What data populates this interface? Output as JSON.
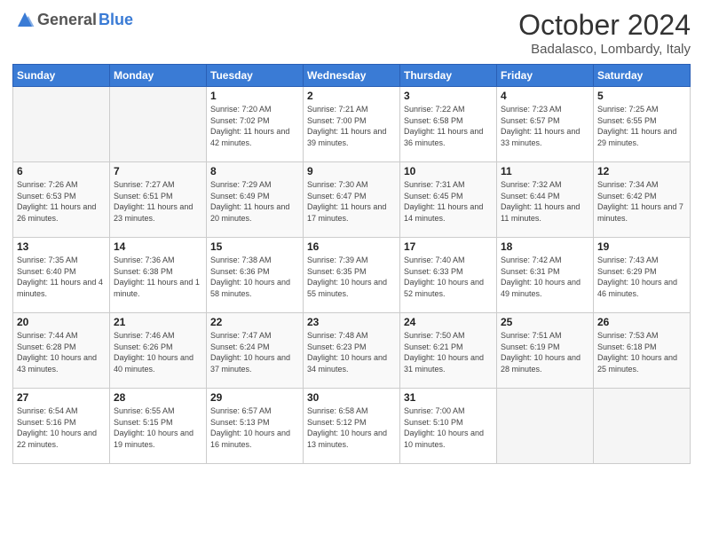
{
  "logo": {
    "general": "General",
    "blue": "Blue"
  },
  "header": {
    "month": "October 2024",
    "location": "Badalasco, Lombardy, Italy"
  },
  "days_of_week": [
    "Sunday",
    "Monday",
    "Tuesday",
    "Wednesday",
    "Thursday",
    "Friday",
    "Saturday"
  ],
  "weeks": [
    [
      {
        "day": "",
        "info": ""
      },
      {
        "day": "",
        "info": ""
      },
      {
        "day": "1",
        "info": "Sunrise: 7:20 AM\nSunset: 7:02 PM\nDaylight: 11 hours and 42 minutes."
      },
      {
        "day": "2",
        "info": "Sunrise: 7:21 AM\nSunset: 7:00 PM\nDaylight: 11 hours and 39 minutes."
      },
      {
        "day": "3",
        "info": "Sunrise: 7:22 AM\nSunset: 6:58 PM\nDaylight: 11 hours and 36 minutes."
      },
      {
        "day": "4",
        "info": "Sunrise: 7:23 AM\nSunset: 6:57 PM\nDaylight: 11 hours and 33 minutes."
      },
      {
        "day": "5",
        "info": "Sunrise: 7:25 AM\nSunset: 6:55 PM\nDaylight: 11 hours and 29 minutes."
      }
    ],
    [
      {
        "day": "6",
        "info": "Sunrise: 7:26 AM\nSunset: 6:53 PM\nDaylight: 11 hours and 26 minutes."
      },
      {
        "day": "7",
        "info": "Sunrise: 7:27 AM\nSunset: 6:51 PM\nDaylight: 11 hours and 23 minutes."
      },
      {
        "day": "8",
        "info": "Sunrise: 7:29 AM\nSunset: 6:49 PM\nDaylight: 11 hours and 20 minutes."
      },
      {
        "day": "9",
        "info": "Sunrise: 7:30 AM\nSunset: 6:47 PM\nDaylight: 11 hours and 17 minutes."
      },
      {
        "day": "10",
        "info": "Sunrise: 7:31 AM\nSunset: 6:45 PM\nDaylight: 11 hours and 14 minutes."
      },
      {
        "day": "11",
        "info": "Sunrise: 7:32 AM\nSunset: 6:44 PM\nDaylight: 11 hours and 11 minutes."
      },
      {
        "day": "12",
        "info": "Sunrise: 7:34 AM\nSunset: 6:42 PM\nDaylight: 11 hours and 7 minutes."
      }
    ],
    [
      {
        "day": "13",
        "info": "Sunrise: 7:35 AM\nSunset: 6:40 PM\nDaylight: 11 hours and 4 minutes."
      },
      {
        "day": "14",
        "info": "Sunrise: 7:36 AM\nSunset: 6:38 PM\nDaylight: 11 hours and 1 minute."
      },
      {
        "day": "15",
        "info": "Sunrise: 7:38 AM\nSunset: 6:36 PM\nDaylight: 10 hours and 58 minutes."
      },
      {
        "day": "16",
        "info": "Sunrise: 7:39 AM\nSunset: 6:35 PM\nDaylight: 10 hours and 55 minutes."
      },
      {
        "day": "17",
        "info": "Sunrise: 7:40 AM\nSunset: 6:33 PM\nDaylight: 10 hours and 52 minutes."
      },
      {
        "day": "18",
        "info": "Sunrise: 7:42 AM\nSunset: 6:31 PM\nDaylight: 10 hours and 49 minutes."
      },
      {
        "day": "19",
        "info": "Sunrise: 7:43 AM\nSunset: 6:29 PM\nDaylight: 10 hours and 46 minutes."
      }
    ],
    [
      {
        "day": "20",
        "info": "Sunrise: 7:44 AM\nSunset: 6:28 PM\nDaylight: 10 hours and 43 minutes."
      },
      {
        "day": "21",
        "info": "Sunrise: 7:46 AM\nSunset: 6:26 PM\nDaylight: 10 hours and 40 minutes."
      },
      {
        "day": "22",
        "info": "Sunrise: 7:47 AM\nSunset: 6:24 PM\nDaylight: 10 hours and 37 minutes."
      },
      {
        "day": "23",
        "info": "Sunrise: 7:48 AM\nSunset: 6:23 PM\nDaylight: 10 hours and 34 minutes."
      },
      {
        "day": "24",
        "info": "Sunrise: 7:50 AM\nSunset: 6:21 PM\nDaylight: 10 hours and 31 minutes."
      },
      {
        "day": "25",
        "info": "Sunrise: 7:51 AM\nSunset: 6:19 PM\nDaylight: 10 hours and 28 minutes."
      },
      {
        "day": "26",
        "info": "Sunrise: 7:53 AM\nSunset: 6:18 PM\nDaylight: 10 hours and 25 minutes."
      }
    ],
    [
      {
        "day": "27",
        "info": "Sunrise: 6:54 AM\nSunset: 5:16 PM\nDaylight: 10 hours and 22 minutes."
      },
      {
        "day": "28",
        "info": "Sunrise: 6:55 AM\nSunset: 5:15 PM\nDaylight: 10 hours and 19 minutes."
      },
      {
        "day": "29",
        "info": "Sunrise: 6:57 AM\nSunset: 5:13 PM\nDaylight: 10 hours and 16 minutes."
      },
      {
        "day": "30",
        "info": "Sunrise: 6:58 AM\nSunset: 5:12 PM\nDaylight: 10 hours and 13 minutes."
      },
      {
        "day": "31",
        "info": "Sunrise: 7:00 AM\nSunset: 5:10 PM\nDaylight: 10 hours and 10 minutes."
      },
      {
        "day": "",
        "info": ""
      },
      {
        "day": "",
        "info": ""
      }
    ]
  ]
}
